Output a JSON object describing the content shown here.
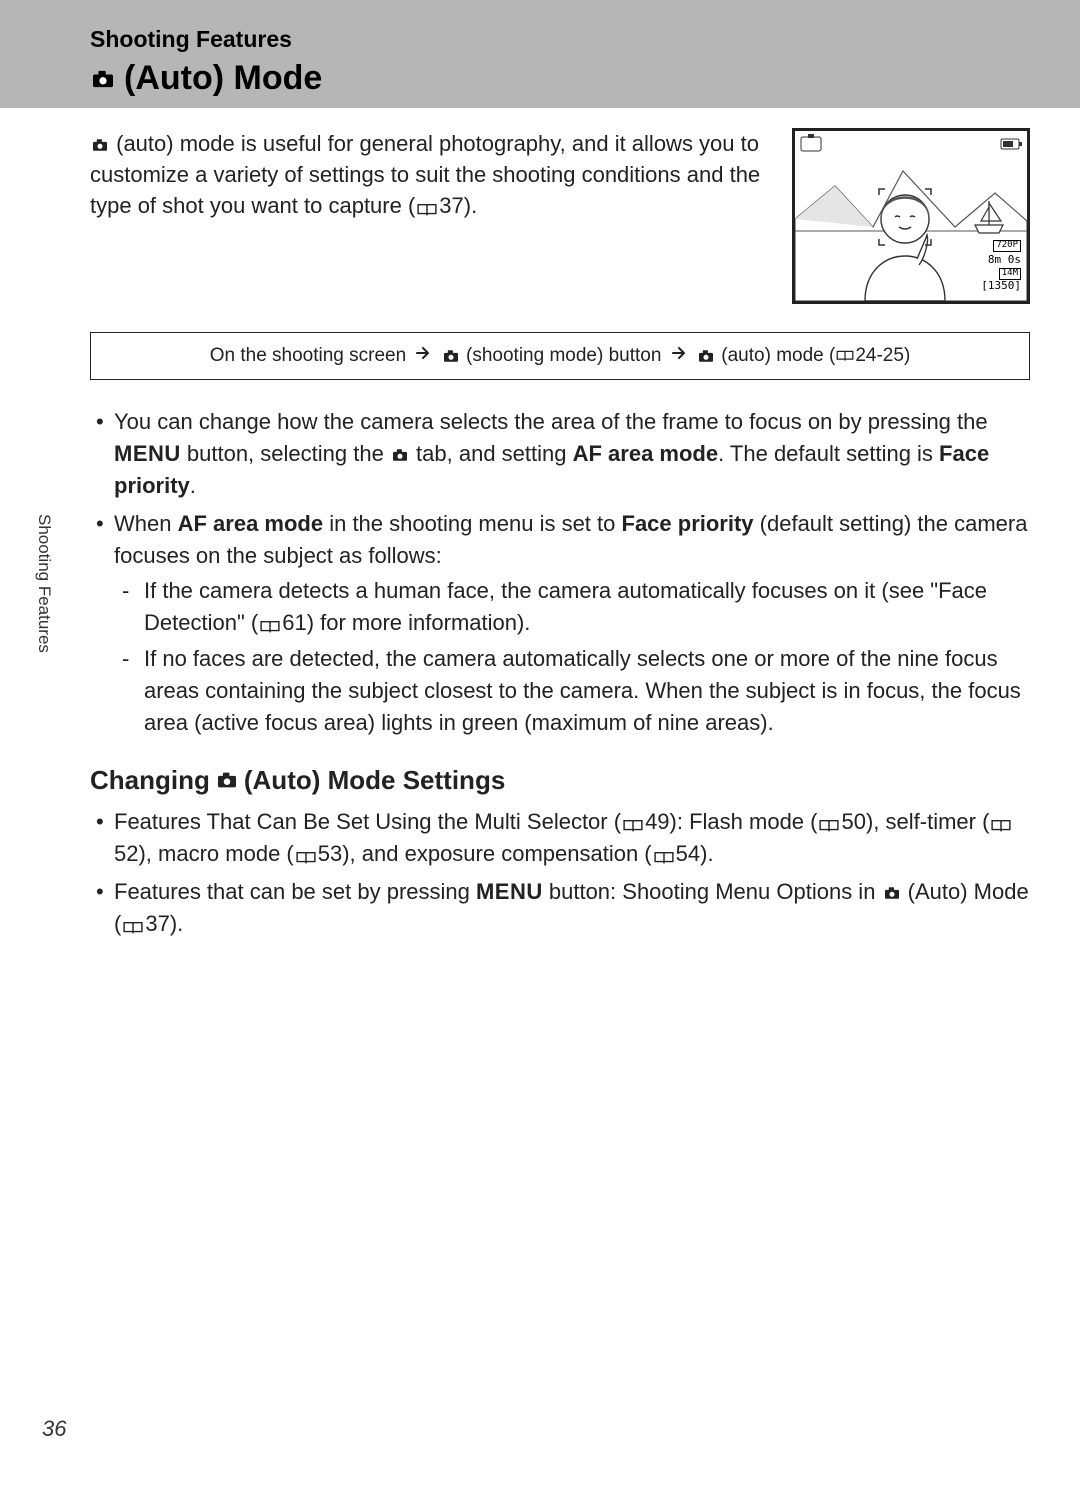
{
  "header": {
    "section": "Shooting Features",
    "title": "(Auto) Mode"
  },
  "intro": {
    "line1": "(auto) mode is useful for general photography, and it allows you to customize a variety of settings to suit the shooting conditions and the type of shot you want to capture (",
    "ref1": "37",
    "line1_end": ")."
  },
  "lcd": {
    "res_badge": "720P",
    "time": "8m 0s",
    "size_badge": "14M",
    "shots": "[1350]"
  },
  "navbox": {
    "lead": "On the shooting screen",
    "step1": "(shooting mode) button",
    "step2": "(auto) mode (",
    "pages": "24-25",
    "end": ")"
  },
  "bullets": {
    "b1_a": "You can change how the camera selects the area of the frame to focus on by pressing the ",
    "b1_menu": "MENU",
    "b1_b": " button, selecting the ",
    "b1_c": " tab, and setting ",
    "b1_af": "AF area mode",
    "b1_d": ". The default setting is ",
    "b1_fp": "Face priority",
    "b1_e": ".",
    "b2_a": "When ",
    "b2_af": "AF area mode",
    "b2_b": " in the shooting menu is set to ",
    "b2_fp": "Face priority",
    "b2_c": " (default setting) the camera focuses on the subject as follows:",
    "d1_a": "If the camera detects a human face, the camera automatically focuses on it (see \"Face Detection\" (",
    "d1_ref": "61",
    "d1_b": ") for more information).",
    "d2": "If no faces are detected, the camera automatically selects one or more of the nine focus areas containing the subject closest to the camera. When the subject is in focus, the focus area (active focus area) lights in green (maximum of nine areas)."
  },
  "subhead": {
    "a": "Changing",
    "b": "(Auto) Mode Settings"
  },
  "bullets2": {
    "b3_a": "Features That Can Be Set Using the Multi Selector (",
    "b3_r1": "49",
    "b3_b": "): Flash mode (",
    "b3_r2": "50",
    "b3_c": "), self-timer (",
    "b3_r3": "52",
    "b3_d": "), macro mode (",
    "b3_r4": "53",
    "b3_e": "), and exposure compensation (",
    "b3_r5": "54",
    "b3_f": ").",
    "b4_a": "Features that can be set by pressing ",
    "b4_menu": "MENU",
    "b4_b": " button: Shooting Menu Options in ",
    "b4_c": " (Auto) Mode (",
    "b4_ref": "37",
    "b4_d": ")."
  },
  "side_tab": "Shooting Features",
  "page_num": "36"
}
